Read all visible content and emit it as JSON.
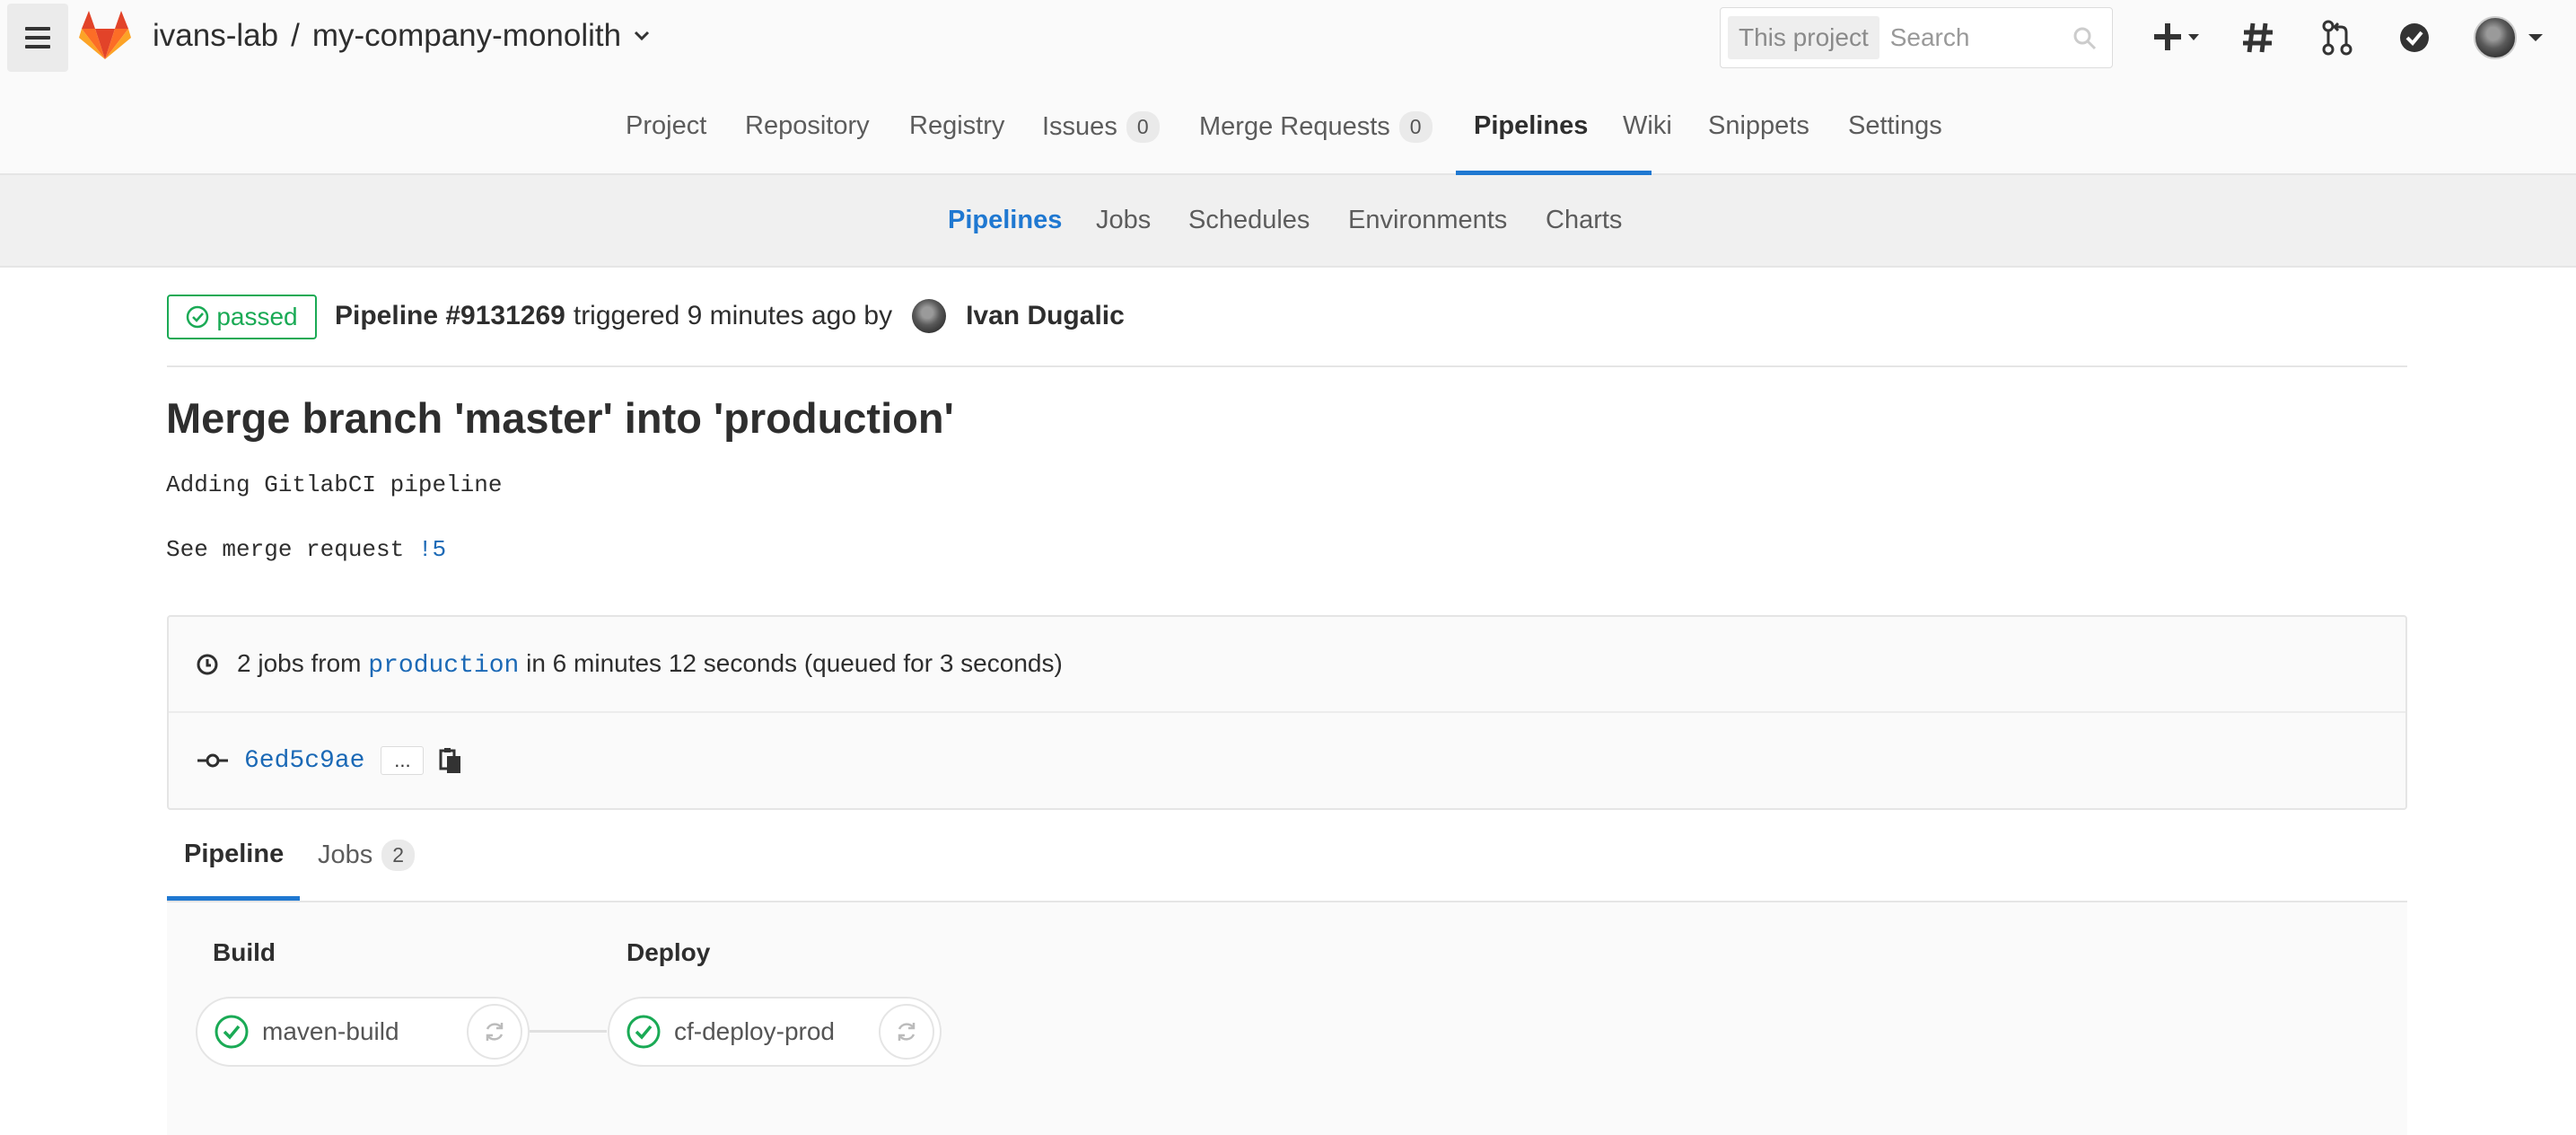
{
  "header": {
    "group": "ivans-lab",
    "separator": "/",
    "project": "my-company-monolith",
    "search": {
      "scope": "This project",
      "placeholder": "Search"
    },
    "icons": [
      "hamburger-icon",
      "gitlab-logo",
      "plus-icon",
      "hash-icon",
      "merge-request-icon",
      "todo-check-icon",
      "user-avatar"
    ]
  },
  "project_nav": {
    "items": [
      {
        "label": "Project"
      },
      {
        "label": "Repository"
      },
      {
        "label": "Registry"
      },
      {
        "label": "Issues",
        "count": "0"
      },
      {
        "label": "Merge Requests",
        "count": "0"
      },
      {
        "label": "Pipelines",
        "active": true
      },
      {
        "label": "Wiki"
      },
      {
        "label": "Snippets"
      },
      {
        "label": "Settings"
      }
    ]
  },
  "sub_nav": {
    "items": [
      {
        "label": "Pipelines",
        "active": true
      },
      {
        "label": "Jobs"
      },
      {
        "label": "Schedules"
      },
      {
        "label": "Environments"
      },
      {
        "label": "Charts"
      }
    ]
  },
  "pipeline": {
    "status": "passed",
    "id_label": "Pipeline #9131269",
    "triggered_text": "triggered 9 minutes ago by",
    "user": "Ivan Dugalic",
    "commit_title": "Merge branch 'master' into 'production'",
    "description_line1": "Adding GitlabCI pipeline",
    "description_line2_prefix": "See merge request ",
    "merge_request_ref": "!5",
    "jobs_summary": {
      "prefix": "2 jobs from",
      "branch": "production",
      "suffix": "in 6 minutes 12 seconds (queued for 3 seconds)"
    },
    "commit_sha": "6ed5c9ae",
    "ellipsis": "...",
    "colors": {
      "success": "#1aaa55",
      "link": "#1b69b6",
      "accent": "#1f78d1"
    }
  },
  "tabs": [
    {
      "label": "Pipeline",
      "active": true
    },
    {
      "label": "Jobs",
      "count": "2"
    }
  ],
  "graph": {
    "stages": [
      {
        "title": "Build",
        "jobs": [
          {
            "name": "maven-build",
            "status": "success"
          }
        ]
      },
      {
        "title": "Deploy",
        "jobs": [
          {
            "name": "cf-deploy-prod",
            "status": "success"
          }
        ]
      }
    ]
  }
}
